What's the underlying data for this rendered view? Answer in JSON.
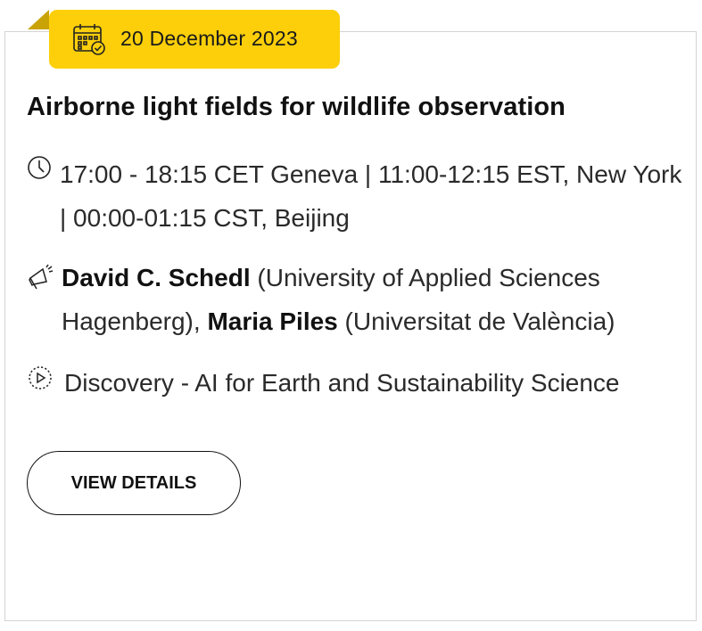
{
  "event": {
    "date": "20 December 2023",
    "title": "Airborne light fields for wildlife observation",
    "time": "17:00 - 18:15 CET Geneva | 11:00-12:15 EST, New York | 00:00-01:15 CST, Beijing",
    "speakers": [
      {
        "name": "David C. Schedl",
        "affiliation": "(University of Applied Sciences Hagenberg),"
      },
      {
        "name": "Maria Piles",
        "affiliation": "(Universitat de València)"
      }
    ],
    "topic": "Discovery - AI for Earth and Sustainability Science",
    "button_label": "VIEW DETAILS"
  },
  "icons": {
    "date": "calendar-check-icon",
    "time": "clock-icon",
    "speakers": "megaphone-icon",
    "topic": "play-circle-icon"
  },
  "colors": {
    "badge": "#fccf0a",
    "badge_fold": "#c9a206",
    "border": "#d4d4d4",
    "text": "#1f1f1f"
  }
}
